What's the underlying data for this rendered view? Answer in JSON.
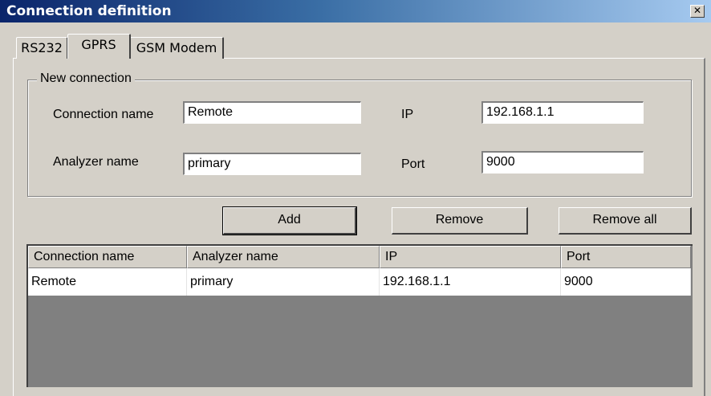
{
  "window": {
    "title": "Connection definition",
    "close_glyph": "✕"
  },
  "tabs": [
    {
      "label": "RS232",
      "active": false
    },
    {
      "label": "GPRS",
      "active": true
    },
    {
      "label": "GSM Modem",
      "active": false
    }
  ],
  "new_connection": {
    "legend": "New connection",
    "connection_name_label": "Connection name",
    "connection_name_value": "Remote",
    "analyzer_name_label": "Analyzer name",
    "analyzer_name_value": "primary",
    "ip_label": "IP",
    "ip_value": "192.168.1.1",
    "port_label": "Port",
    "port_value": "9000"
  },
  "buttons": {
    "add": "Add",
    "remove": "Remove",
    "remove_all": "Remove all"
  },
  "connections_table": {
    "columns": [
      "Connection name",
      "Analyzer name",
      "IP",
      "Port"
    ],
    "rows": [
      [
        "Remote",
        "primary",
        "192.168.1.1",
        "9000"
      ]
    ]
  }
}
